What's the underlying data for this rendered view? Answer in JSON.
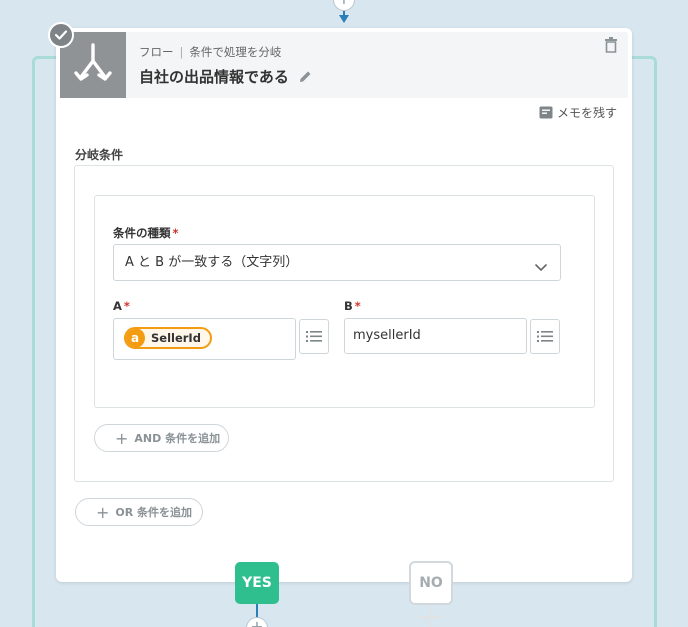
{
  "node": {
    "breadcrumb_parent": "フロー",
    "breadcrumb_current": "条件で処理を分岐",
    "title": "自社の出品情報である",
    "memo_label": "メモを残す"
  },
  "branch": {
    "section_label": "分岐条件",
    "condition_type_label": "条件の種類",
    "condition_type_value": "A と B が一致する（文字列）",
    "a_label": "A",
    "a_chip_logo": "a",
    "a_chip_text": "SellerId",
    "b_label": "B",
    "b_value": "mysellerId",
    "required_mark": "*",
    "add_and_label": "AND 条件を追加",
    "add_or_label": "OR 条件を追加",
    "plus": "+"
  },
  "outcomes": {
    "yes_label": "YES",
    "no_label": "NO"
  },
  "colors": {
    "accent_blue": "#2a7fb8",
    "yes_green": "#2fbf8f",
    "amazon_orange": "#f39c12",
    "frame_teal": "#a9dcd6"
  },
  "icons": [
    "plus-icon",
    "branch-icon",
    "check-icon",
    "pencil-icon",
    "trash-icon",
    "memo-icon",
    "chevron-down-icon",
    "list-icon"
  ]
}
